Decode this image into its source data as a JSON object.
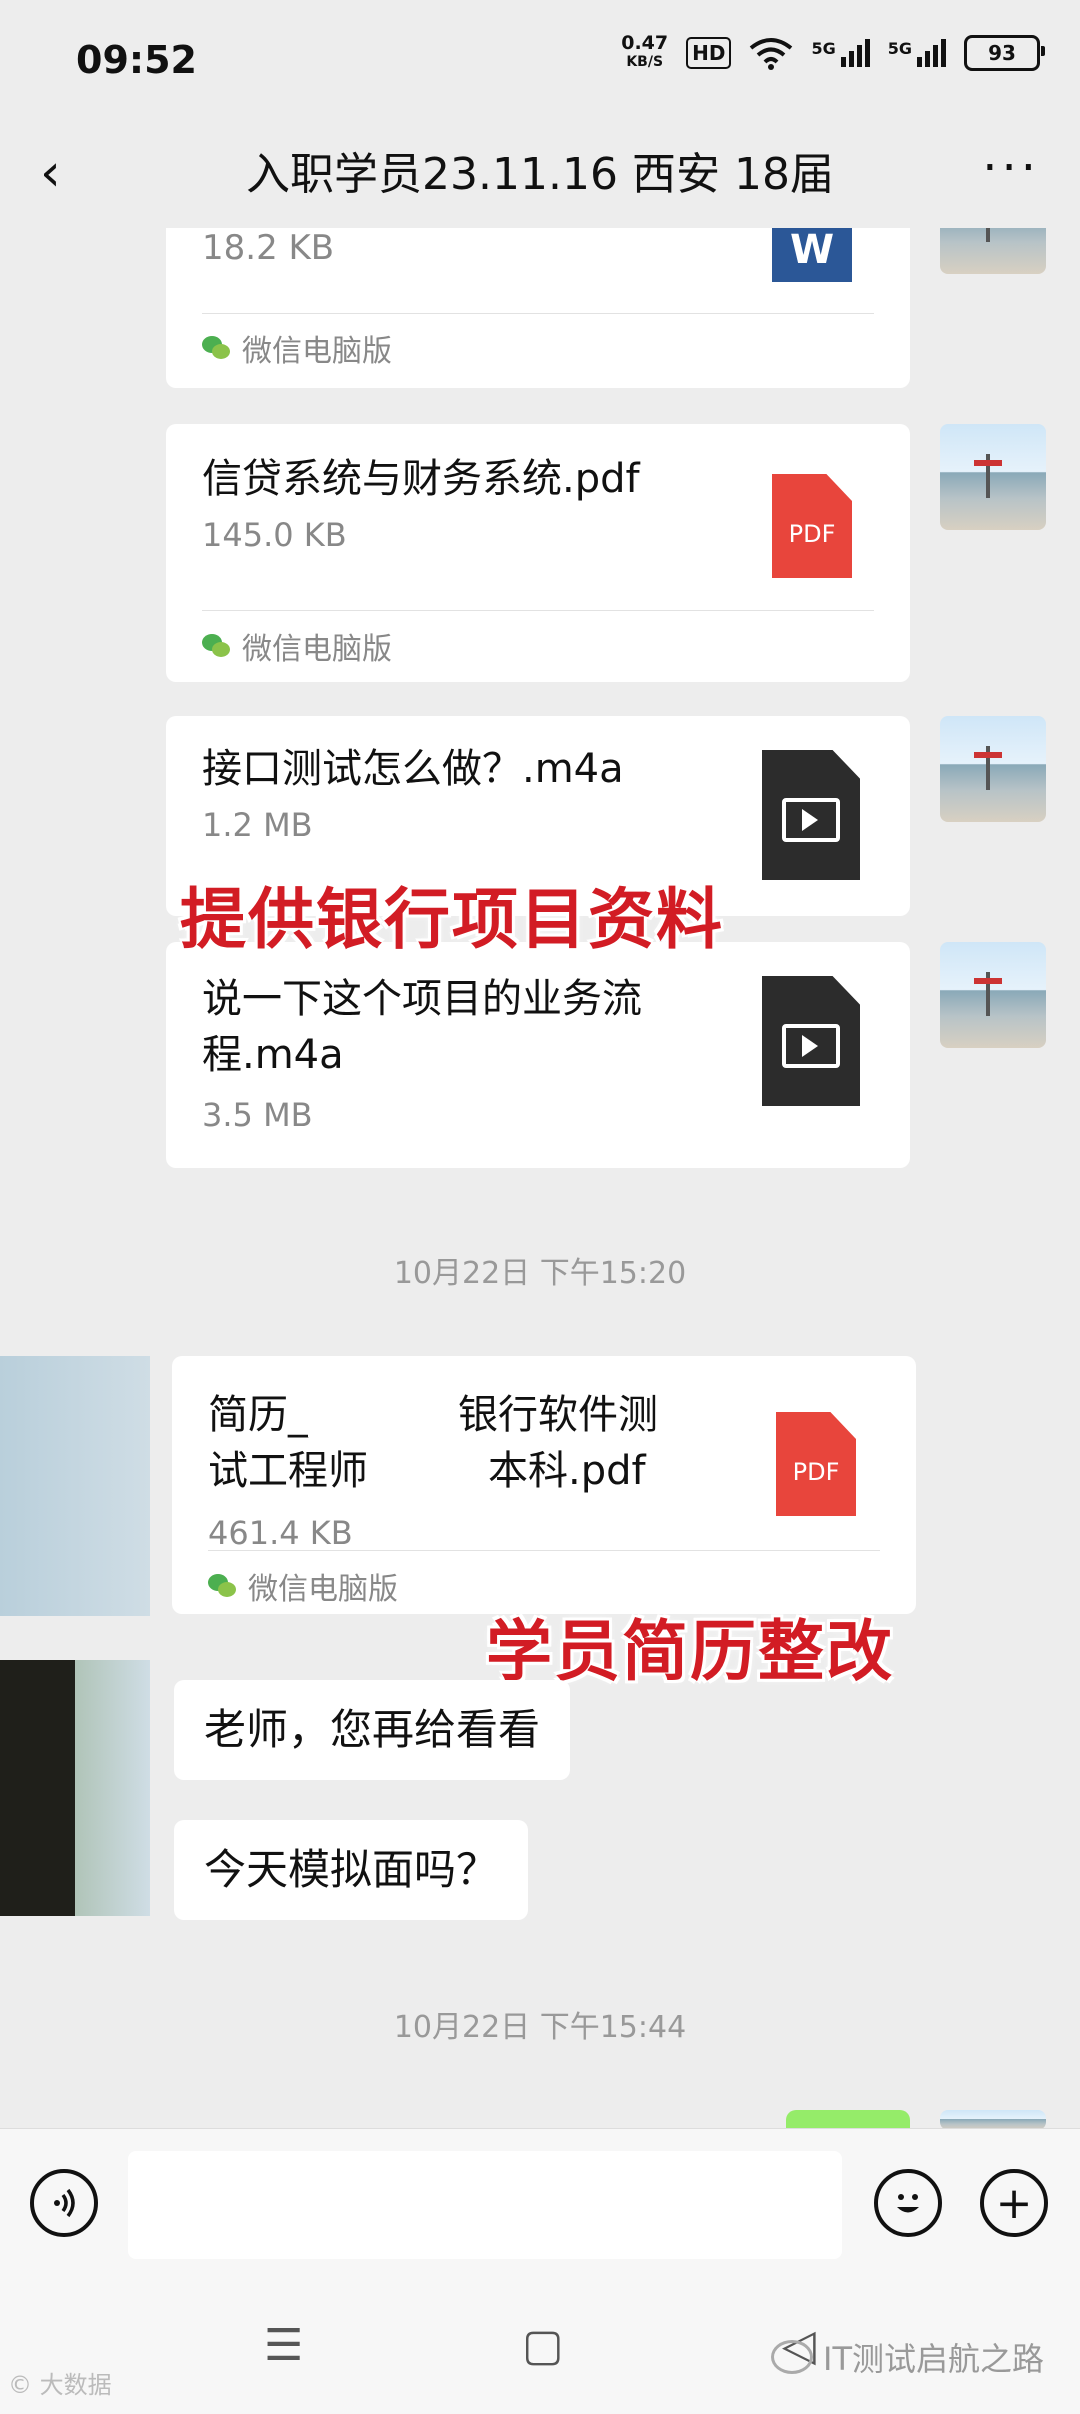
{
  "status": {
    "time": "09:52",
    "speed_value": "0.47",
    "speed_unit": "KB/S",
    "hd": "HD",
    "sig1": "5G",
    "sig2": "5G",
    "battery": "93"
  },
  "header": {
    "title": "入职学员23.11.16 西安  18届",
    "back_icon": "‹",
    "more_icon": "···"
  },
  "messages": {
    "file0": {
      "size": "18.2 KB",
      "source": "微信电脑版",
      "icon_label": "W"
    },
    "file1": {
      "name": "信贷系统与财务系统.pdf",
      "size": "145.0 KB",
      "source": "微信电脑版",
      "icon_label": "PDF"
    },
    "file2": {
      "name": "接口测试怎么做？.m4a",
      "size": "1.2 MB"
    },
    "file3": {
      "name_line1": "说一下这个项目的业务流",
      "name_line2": "程.m4a",
      "size": "3.5 MB"
    },
    "timestamp1": "10月22日 下午15:20",
    "file4": {
      "name_line1": "简历_",
      "name_line1b": "银行软件测",
      "name_line2": "试工程师",
      "name_line2b": "本科.pdf",
      "size": "461.4 KB",
      "source": "微信电脑版",
      "icon_label": "PDF"
    },
    "text1": "老师，您再给看看",
    "text2": "今天模拟面吗？",
    "timestamp2": "10月22日 下午15:44"
  },
  "overlays": {
    "top": "提供银行项目资料",
    "bottom": "学员简历整改"
  },
  "inputbar": {
    "voice_icon": "voice-icon",
    "emoji_icon": "emoji-icon",
    "plus": "+"
  },
  "navbar": {
    "menu": "☰",
    "home": "▢",
    "back": "◁"
  },
  "watermark": {
    "left": "© 大数据",
    "right": "IT测试启航之路"
  },
  "colors": {
    "pdf": "#e8453c",
    "word": "#2b5797",
    "overlay_text": "#d21c24",
    "background": "#ededed"
  }
}
